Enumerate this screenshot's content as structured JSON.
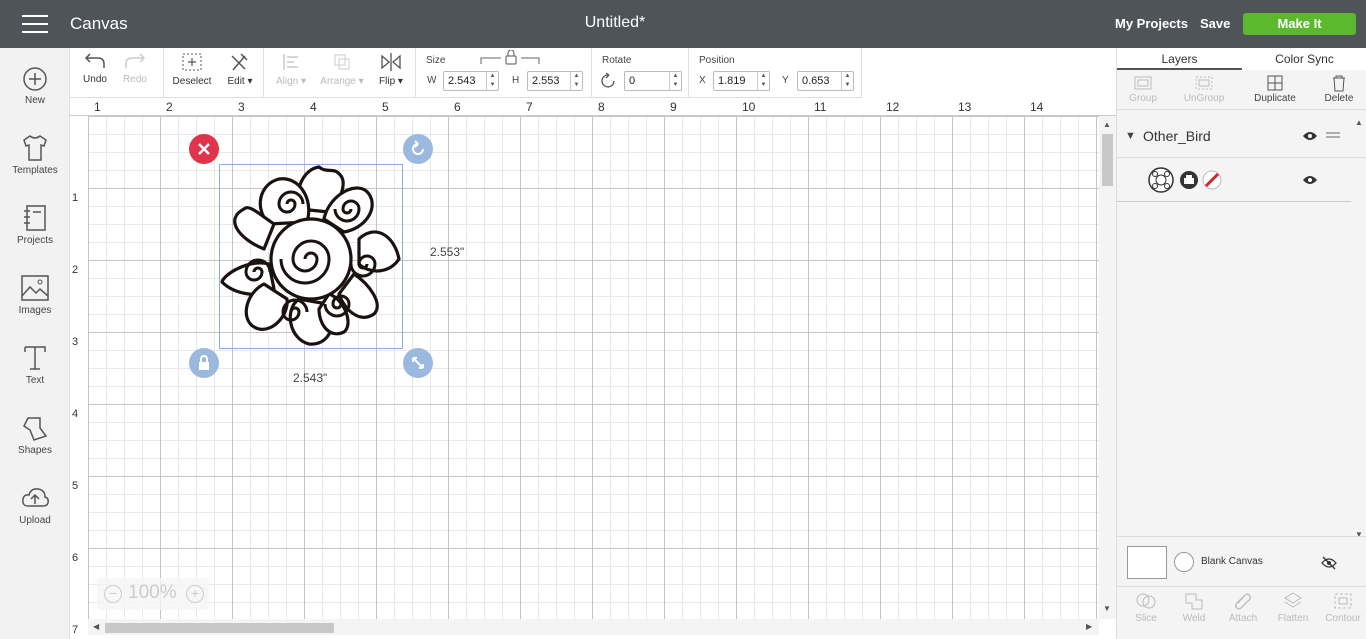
{
  "header": {
    "app_title": "Canvas",
    "doc_title": "Untitled*",
    "my_projects": "My Projects",
    "save": "Save",
    "make_it": "Make It",
    "accent_color": "#5cb82e",
    "bar_color": "#4f5459"
  },
  "sidebar": {
    "items": [
      {
        "label": "New",
        "icon": "plus-circle-icon"
      },
      {
        "label": "Templates",
        "icon": "shirt-icon"
      },
      {
        "label": "Projects",
        "icon": "notebook-icon"
      },
      {
        "label": "Images",
        "icon": "image-icon"
      },
      {
        "label": "Text",
        "icon": "text-T-icon"
      },
      {
        "label": "Shapes",
        "icon": "shapes-icon"
      },
      {
        "label": "Upload",
        "icon": "cloud-upload-icon"
      }
    ]
  },
  "toolbar": {
    "undo": "Undo",
    "redo": "Redo",
    "deselect": "Deselect",
    "edit": "Edit",
    "align": "Align",
    "arrange": "Arrange",
    "flip": "Flip",
    "size_label": "Size",
    "w_label": "W",
    "w_value": "2.543",
    "h_label": "H",
    "h_value": "2.553",
    "rotate_label": "Rotate",
    "rotate_value": "0",
    "position_label": "Position",
    "x_label": "X",
    "x_value": "1.819",
    "y_label": "Y",
    "y_value": "0.653"
  },
  "rulers": {
    "horizontal": [
      "1",
      "2",
      "3",
      "4",
      "5",
      "6",
      "7",
      "8",
      "9",
      "10",
      "11",
      "12",
      "13",
      "14"
    ],
    "vertical": [
      "1",
      "2",
      "3",
      "4",
      "5",
      "6",
      "7"
    ]
  },
  "canvas": {
    "height_dim": "2.553\"",
    "width_dim": "2.543\"",
    "zoom": "100%",
    "zoom_minus": "−",
    "zoom_plus": "+"
  },
  "right_panel": {
    "tabs": [
      "Layers",
      "Color Sync"
    ],
    "tools": [
      {
        "label": "Group",
        "enabled": false
      },
      {
        "label": "UnGroup",
        "enabled": false
      },
      {
        "label": "Duplicate",
        "enabled": true
      },
      {
        "label": "Delete",
        "enabled": true
      }
    ],
    "layer_group_name": "Other_Bird",
    "blank_canvas": "Blank Canvas",
    "bottom_tools": [
      "Slice",
      "Weld",
      "Attach",
      "Flatten",
      "Contour"
    ],
    "cut_color": "#e02020"
  }
}
